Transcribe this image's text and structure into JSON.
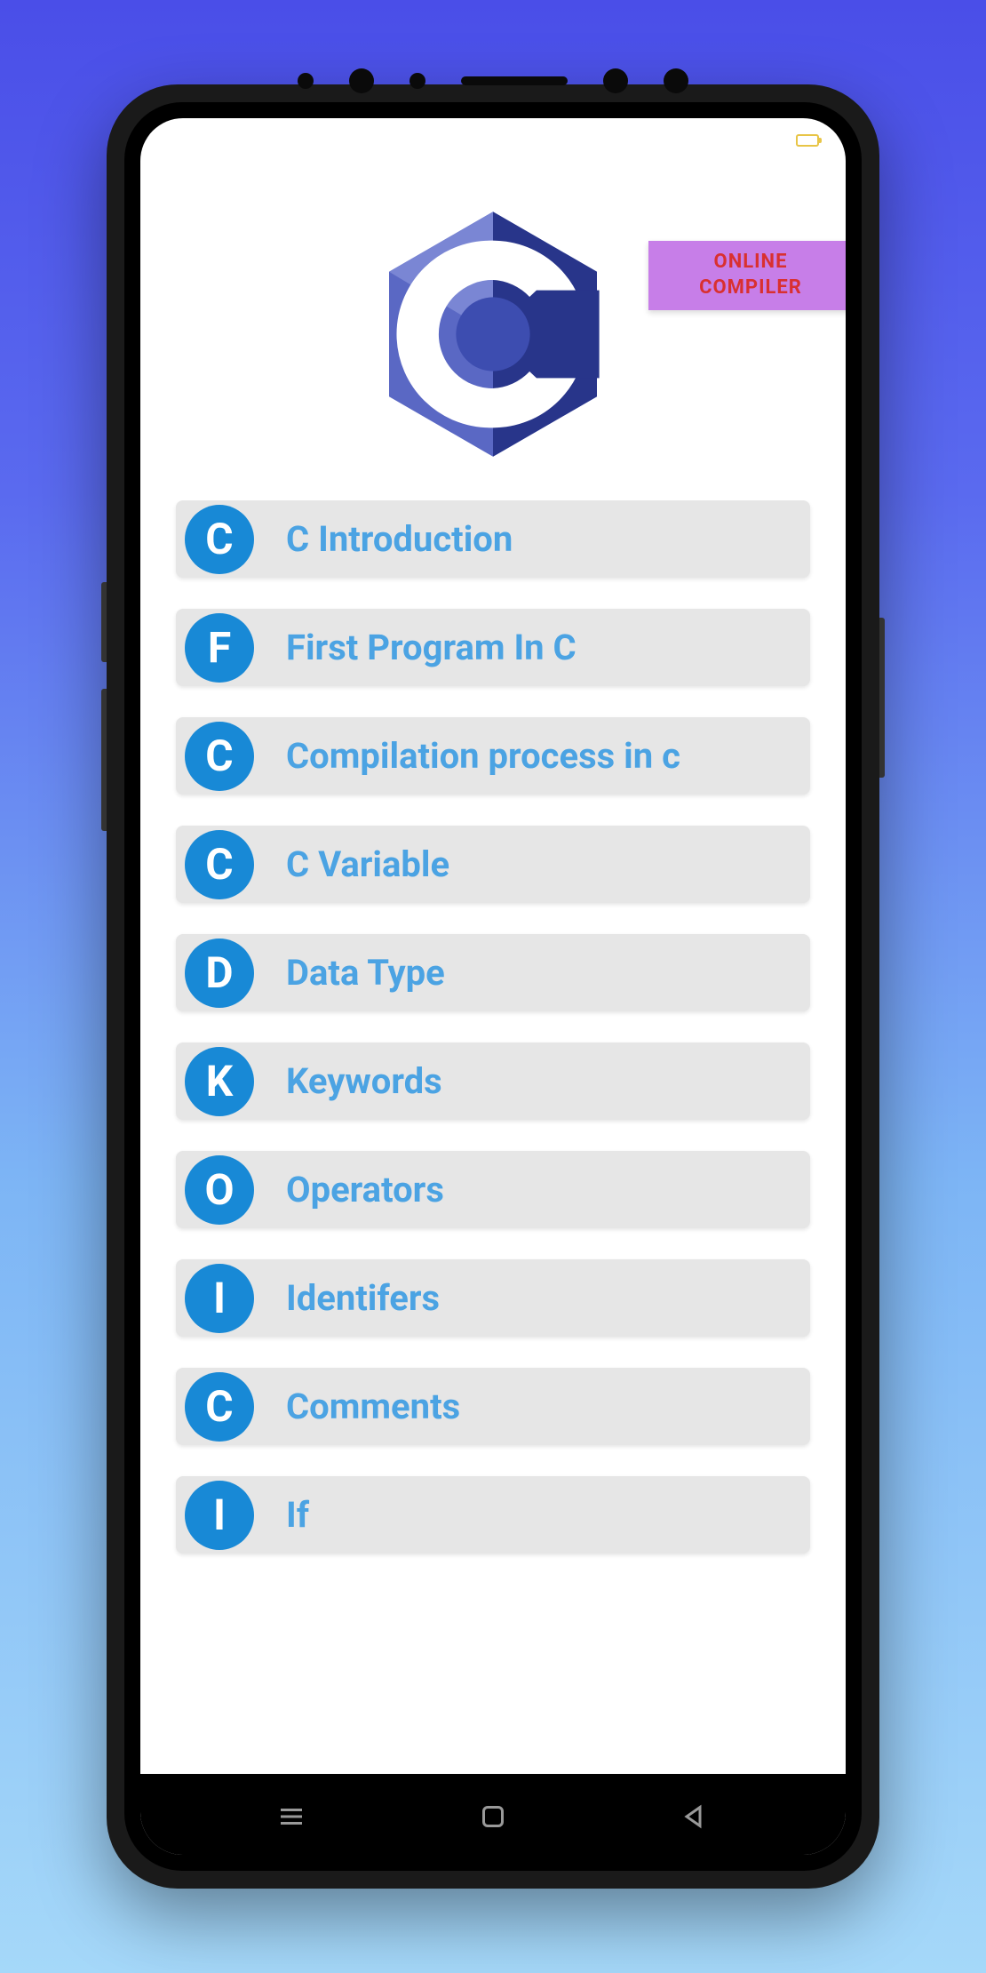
{
  "header": {
    "compiler_button_line1": "ONLINE",
    "compiler_button_line2": "COMPILER"
  },
  "topics": [
    {
      "badge": "C",
      "label": "C Introduction"
    },
    {
      "badge": "F",
      "label": "First Program In C"
    },
    {
      "badge": "C",
      "label": "Compilation process in c"
    },
    {
      "badge": "C",
      "label": "C Variable"
    },
    {
      "badge": "D",
      "label": "Data Type"
    },
    {
      "badge": "K",
      "label": "Keywords"
    },
    {
      "badge": "O",
      "label": "Operators"
    },
    {
      "badge": "I",
      "label": "Identifers"
    },
    {
      "badge": "C",
      "label": "Comments"
    },
    {
      "badge": "I",
      "label": "If"
    }
  ]
}
